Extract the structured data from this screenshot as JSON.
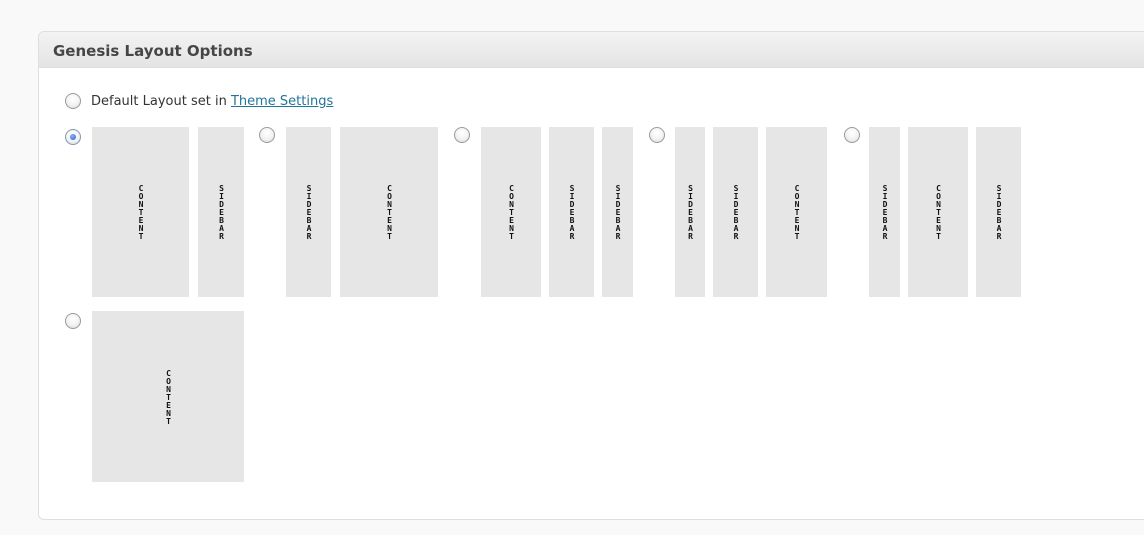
{
  "metabox": {
    "title": "Genesis Layout Options"
  },
  "default_option": {
    "label_prefix": "Default Layout set in",
    "link_text": "Theme Settings",
    "selected": false
  },
  "column_labels": {
    "content": "CONTENT",
    "sidebar": "SIDEBAR"
  },
  "layouts": [
    {
      "name": "content-sidebar",
      "selected": true,
      "columns": [
        "content",
        "sidebar"
      ]
    },
    {
      "name": "sidebar-content",
      "selected": false,
      "columns": [
        "sidebar",
        "content"
      ]
    },
    {
      "name": "content-sidebar-sidebar",
      "selected": false,
      "columns": [
        "content",
        "sidebar",
        "sidebar"
      ]
    },
    {
      "name": "sidebar-sidebar-content",
      "selected": false,
      "columns": [
        "sidebar",
        "sidebar",
        "content"
      ]
    },
    {
      "name": "sidebar-content-sidebar",
      "selected": false,
      "columns": [
        "sidebar",
        "content",
        "sidebar"
      ]
    },
    {
      "name": "full-width-content",
      "selected": false,
      "columns": [
        "content"
      ]
    }
  ]
}
